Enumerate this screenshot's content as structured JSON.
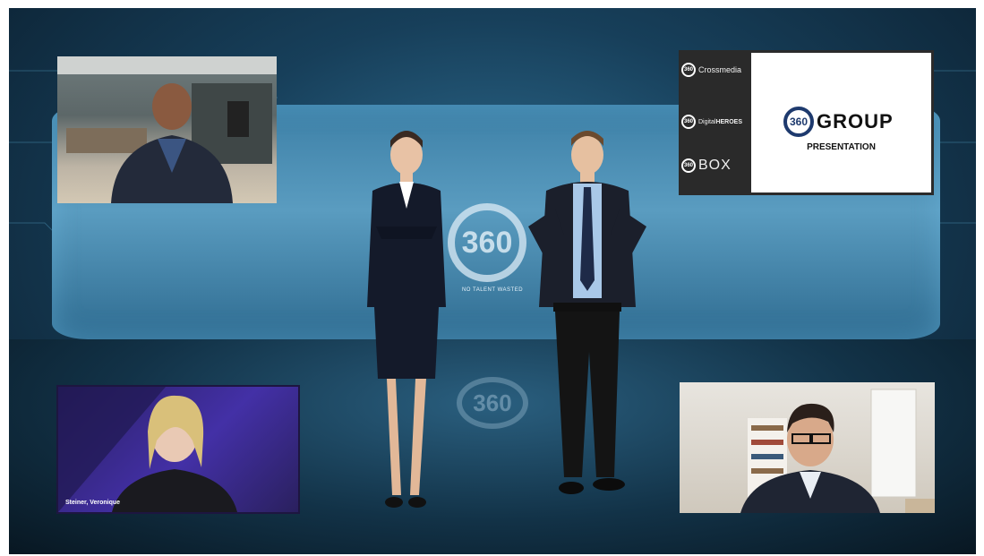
{
  "scene": {
    "screen_tag": "NO TALENT WASTED",
    "screen_logo": "360",
    "floor_logo": "360",
    "accent": "#2f6f93"
  },
  "tiles": {
    "bottom_left": {
      "name_label": "Steiner, Veronique"
    }
  },
  "branding": {
    "items": [
      {
        "mark": "360",
        "label": "Crossmedia"
      },
      {
        "mark": "360",
        "label": "Digital",
        "label_bold": "HEROES"
      },
      {
        "mark": "360",
        "label": "BOX"
      }
    ],
    "group_mark": "360",
    "group_word": "GROUP",
    "presentation": "PRESENTATION"
  }
}
